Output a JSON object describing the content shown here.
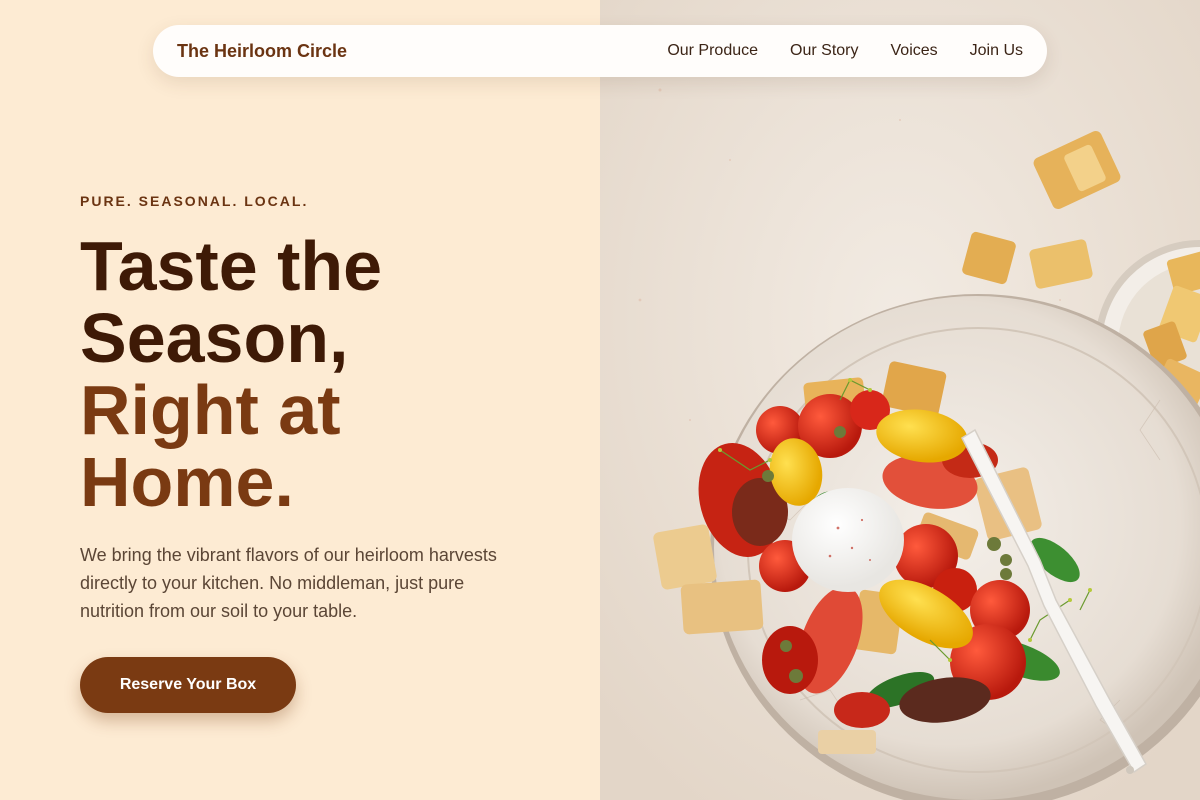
{
  "nav": {
    "brand": "The Heirloom Circle",
    "links": [
      "Our Produce",
      "Our Story",
      "Voices",
      "Join Us"
    ]
  },
  "hero": {
    "eyebrow": "PURE. SEASONAL. LOCAL.",
    "headline_line1": "Taste the",
    "headline_line2": "Season,",
    "headline_line3": "Right at",
    "headline_line4": "Home.",
    "description": "We bring the vibrant flavors of our heirloom harvests directly to your kitchen. No middleman, just pure nutrition from our soil to your table.",
    "cta_label": "Reserve Your Box"
  },
  "colors": {
    "background": "#fdebd3",
    "brand_brown": "#7a3a12",
    "headline_dark": "#3e1a06",
    "text_muted": "#5b4636"
  },
  "image": {
    "subject": "panzanella-salad-bowl-photo"
  }
}
